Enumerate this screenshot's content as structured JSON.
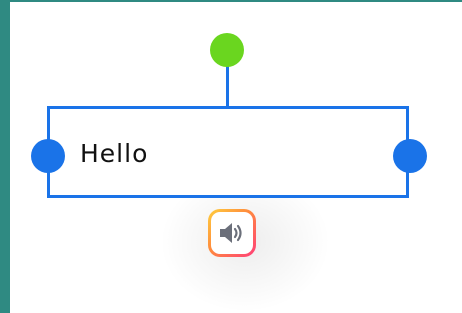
{
  "canvas": {
    "textbox": {
      "text": "Hello"
    },
    "handles": {
      "rotate_color": "#6ad61f",
      "resize_color": "#1a73e8"
    },
    "audio_button": {
      "icon": "speaker-icon"
    }
  }
}
